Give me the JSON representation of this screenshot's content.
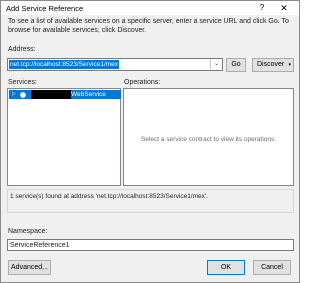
{
  "window": {
    "title": "Add Service Reference",
    "help_glyph": "?",
    "close_glyph": "✕"
  },
  "description": "To see a list of available services on a specific server, enter a service URL and click Go. To browse for available services, click Discover.",
  "address": {
    "label": "Address:",
    "value": "net.tcp://localhost:8523/Service1/mex",
    "caret": "⌄"
  },
  "buttons": {
    "go": "Go",
    "discover": "Discover",
    "discover_caret": "▾",
    "advanced": "Advanced...",
    "ok": "OK",
    "cancel": "Cancel"
  },
  "services": {
    "label": "Services:",
    "item": {
      "arrow": "▷",
      "label": "WebService"
    }
  },
  "operations": {
    "label": "Operations:",
    "hint": "Select a service contract to view its operations."
  },
  "status": "1 service(s) found at address 'net.tcp://localhost:8523/Service1/mex'.",
  "namespace": {
    "label": "Namespace:",
    "value": "ServiceReference1"
  },
  "colors": {
    "selection": "#0078d7",
    "dialog_bg": "#f0f0f0",
    "accent_border": "#0078d7"
  }
}
